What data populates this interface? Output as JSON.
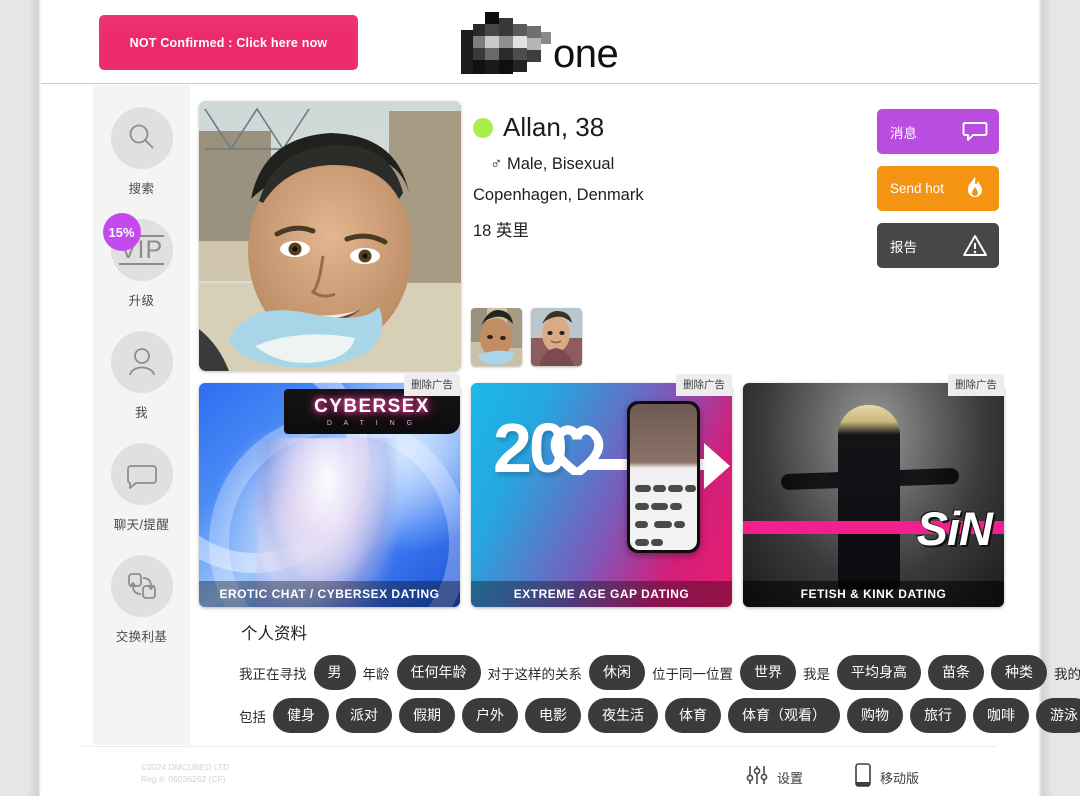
{
  "header": {
    "confirm_banner": "NOT Confirmed : Click here now",
    "logo_word": "one",
    "logo_icon": "pixelated-logo-icon"
  },
  "sidebar": {
    "items": [
      {
        "label": "搜索",
        "icon": "search-icon",
        "name": "search"
      },
      {
        "label": "升级",
        "icon": "vip-icon",
        "name": "upgrade",
        "badge": "15%"
      },
      {
        "label": "我",
        "icon": "person-icon",
        "name": "me"
      },
      {
        "label": "聊天/提醒",
        "icon": "chat-bubble-icon",
        "name": "chat"
      },
      {
        "label": "交换利基",
        "icon": "swap-icon",
        "name": "swap-niche"
      }
    ]
  },
  "profile": {
    "name": "Allan, 38",
    "status": "online",
    "gender_line": "♂ Male, Bisexual",
    "location": "Copenhagen, Denmark",
    "distance": "18 英里",
    "photo_alt": "profile-photo",
    "thumbnails": [
      "thumbnail-1",
      "thumbnail-2"
    ]
  },
  "actions": [
    {
      "label": "消息",
      "icon": "message-bubble-icon",
      "color": "#bb4ce0",
      "name": "message"
    },
    {
      "label": "Send hot",
      "icon": "flame-icon",
      "color": "#f59412",
      "name": "send-hot"
    },
    {
      "label": "报告",
      "icon": "warning-triangle-icon",
      "color": "#474747",
      "name": "report"
    }
  ],
  "ads": {
    "remove_label": "删除广告",
    "items": [
      {
        "id": "cybersex",
        "logo_title": "CYBERSEX",
        "logo_sub": "D A T I N G",
        "caption": "EROTIC CHAT / CYBERSEX DATING"
      },
      {
        "id": "agegap",
        "big_number": "20",
        "caption": "EXTREME AGE GAP DATING"
      },
      {
        "id": "sin",
        "logo_title": "SiN",
        "caption": "FETISH & KINK DATING"
      }
    ]
  },
  "profile_section": {
    "title": "个人资料",
    "row1": [
      {
        "type": "text",
        "value": "我正在寻找"
      },
      {
        "type": "pill",
        "value": "男"
      },
      {
        "type": "text",
        "value": "年龄"
      },
      {
        "type": "pill",
        "value": "任何年龄"
      },
      {
        "type": "text",
        "value": "对于这样的关系"
      },
      {
        "type": "pill",
        "value": "休闲"
      },
      {
        "type": "text",
        "value": "位于同一位置"
      },
      {
        "type": "pill",
        "value": "世界"
      },
      {
        "type": "text",
        "value": "我是"
      },
      {
        "type": "pill",
        "value": "平均身高"
      },
      {
        "type": "pill",
        "value": "苗条"
      },
      {
        "type": "pill",
        "value": "种类"
      },
      {
        "type": "text",
        "value": "我的兴趣"
      }
    ],
    "row2": [
      {
        "type": "text",
        "value": "包括"
      },
      {
        "type": "pill",
        "value": "健身"
      },
      {
        "type": "pill",
        "value": "派对"
      },
      {
        "type": "pill",
        "value": "假期"
      },
      {
        "type": "pill",
        "value": "户外"
      },
      {
        "type": "pill",
        "value": "电影"
      },
      {
        "type": "pill",
        "value": "夜生活"
      },
      {
        "type": "pill",
        "value": "体育"
      },
      {
        "type": "pill",
        "value": "体育（观看）"
      },
      {
        "type": "pill",
        "value": "购物"
      },
      {
        "type": "pill",
        "value": "旅行"
      },
      {
        "type": "pill",
        "value": "咖啡"
      },
      {
        "type": "pill",
        "value": "游泳"
      }
    ]
  },
  "footer": {
    "copyright_line1": "©2024 DMCUBED LTD",
    "copyright_line2": "Reg #: 06036262 (CF)",
    "actions": [
      {
        "label": "设置",
        "icon": "sliders-icon",
        "name": "settings"
      },
      {
        "label": "移动版",
        "icon": "mobile-phone-icon",
        "name": "mobile-version"
      }
    ]
  }
}
